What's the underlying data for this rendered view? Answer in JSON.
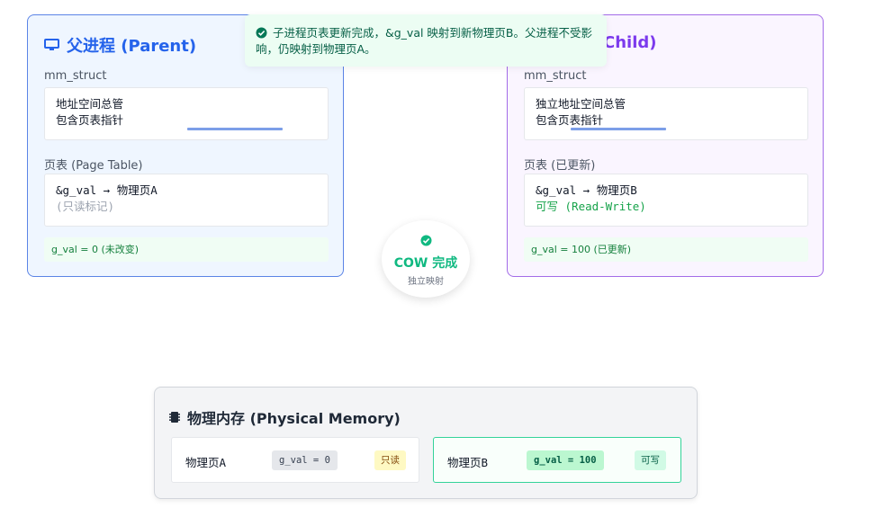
{
  "toast": {
    "message": "子进程页表更新完成，&g_val 映射到新物理页B。父进程不受影响，仍映射到物理页A。",
    "icon": "check-circle-icon"
  },
  "parent": {
    "title": "父进程 (Parent)",
    "mm_label": "mm_struct",
    "mm_line1": "地址空间总管",
    "mm_line2": "包含页表指针",
    "pt_label": "页表 (Page Table)",
    "pt_line1": "&g_val → 物理页A",
    "pt_line2": "(只读标记)",
    "note": "g_val = 0 (未改变)"
  },
  "child": {
    "title_visible": "Child)",
    "mm_label": "mm_struct",
    "mm_line1": "独立地址空间总管",
    "mm_line2": "包含页表指针",
    "pt_label": "页表 (已更新)",
    "pt_line1": "&g_val → 物理页B",
    "pt_line2": "可写 (Read-Write)",
    "note": "g_val = 100 (已更新)"
  },
  "cow": {
    "title": "COW 完成",
    "subtitle": "独立映射"
  },
  "memory": {
    "title": "物理内存 (Physical Memory)",
    "pages": [
      {
        "name": "物理页A",
        "value": "g_val = 0",
        "perm": "只读"
      },
      {
        "name": "物理页B",
        "value": "g_val = 100",
        "perm": "可写"
      }
    ]
  },
  "colors": {
    "parent_accent": "#2563eb",
    "child_accent": "#7c3aed",
    "success": "#10b981",
    "readonly": "#fef9c3"
  }
}
